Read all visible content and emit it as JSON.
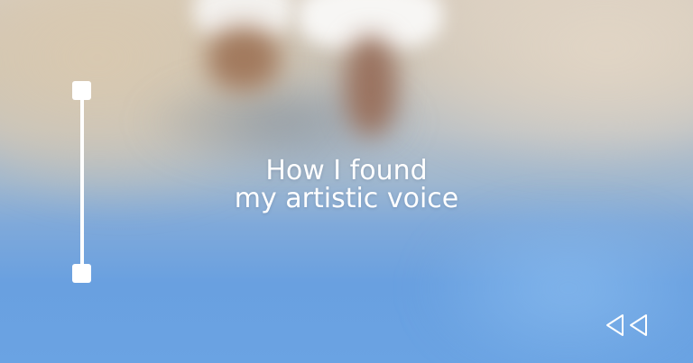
{
  "hero": {
    "title_line1": "How I found",
    "title_line2": "my artistic voice"
  },
  "slider": {
    "level": 0
  },
  "icons": {
    "rewind": "rewind-icon"
  },
  "colors": {
    "text": "#ffffff",
    "accent": "#ffffff"
  }
}
